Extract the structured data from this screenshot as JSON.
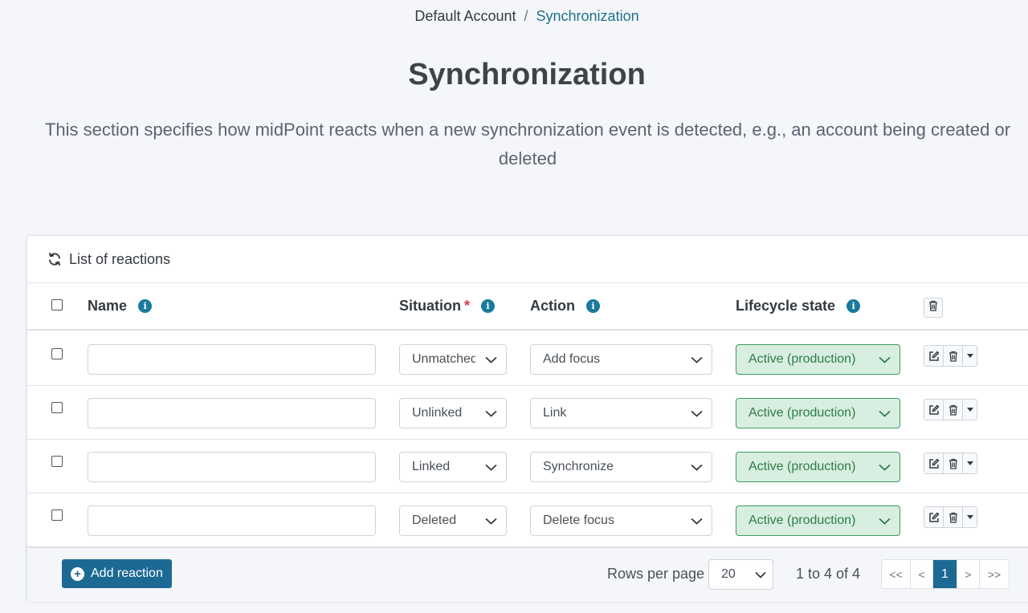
{
  "breadcrumb": {
    "parent": "Default Account",
    "separator": "/",
    "current": "Synchronization"
  },
  "page": {
    "title": "Synchronization",
    "description": "This section specifies how midPoint reacts when a new synchronization event is detected, e.g., an account being created or deleted"
  },
  "card": {
    "title": "List of reactions",
    "icon": "refresh-icon"
  },
  "table": {
    "columns": {
      "name": "Name",
      "situation": "Situation",
      "situation_required": "*",
      "action": "Action",
      "lifecycle": "Lifecycle state"
    },
    "rows": [
      {
        "name": "",
        "situation": "Unmatched",
        "action": "Add focus",
        "lifecycle": "Active (production)"
      },
      {
        "name": "",
        "situation": "Unlinked",
        "action": "Link",
        "lifecycle": "Active (production)"
      },
      {
        "name": "",
        "situation": "Linked",
        "action": "Synchronize",
        "lifecycle": "Active (production)"
      },
      {
        "name": "",
        "situation": "Deleted",
        "action": "Delete focus",
        "lifecycle": "Active (production)"
      }
    ]
  },
  "footer": {
    "add_label": "Add reaction",
    "rows_per_page_label": "Rows per page",
    "rows_per_page_value": "20",
    "range_text": "1 to 4 of 4",
    "pager": {
      "first": "<<",
      "prev": "<",
      "current": "1",
      "next": ">",
      "last": ">>"
    }
  },
  "colors": {
    "accent": "#1c6a94",
    "info_icon": "#1a7a9e",
    "lifecycle_bg": "#d8eee0",
    "lifecycle_border": "#3c9a5f",
    "required": "#dc3545"
  }
}
